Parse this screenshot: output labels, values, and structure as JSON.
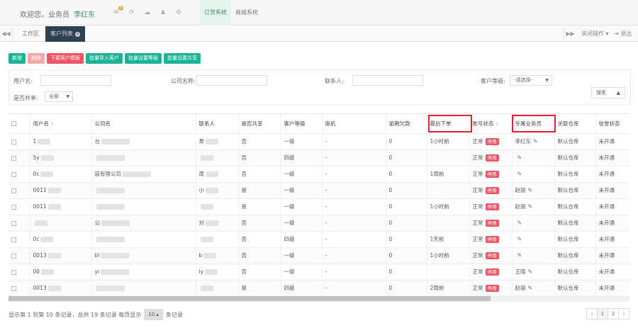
{
  "header": {
    "welcome": "欢迎您，业务员",
    "username": "李红东",
    "icons": [
      "envelope-icon",
      "refresh-icon",
      "cloud-icon",
      "user-icon",
      "gear-icon"
    ],
    "mail_badge": "1",
    "nav": [
      "订货系统",
      "商城系统"
    ]
  },
  "tabs": {
    "left_arrow": "◀◀",
    "items": [
      "工作区",
      "客户列表"
    ],
    "right_arrow": "▶▶",
    "close_ops": "关闭操作",
    "exit": "退出"
  },
  "toolbar": {
    "buttons": [
      "新增",
      "删除",
      "下载客户模板",
      "批量导入客户",
      "批量设置等级",
      "批量设置共享"
    ]
  },
  "search": {
    "username_label": "用户名:",
    "company_label": "公司名称:",
    "contact_label": "联系人:",
    "level_label": "客户等级:",
    "level_value": "-请选择-",
    "shared_label": "是否共享:",
    "shared_value": "全部",
    "collapse_label": "搜索"
  },
  "table": {
    "headers": [
      "用户名",
      "公司名",
      "联系人",
      "是否共享",
      "客户等级",
      "座机",
      "逾期欠款",
      "最后下单",
      "账号状态",
      "专属业务员",
      "关联仓库",
      "信誉状态"
    ],
    "rows": [
      {
        "user": "1",
        "company": "台",
        "contact": "寿",
        "shared": "否",
        "level": "一级",
        "phone": "-",
        "debt": "0",
        "last_order": "1小时前",
        "status": "正常",
        "badge": "停用",
        "salesman": "李红东",
        "warehouse": "默认仓库",
        "credit": "未开通"
      },
      {
        "user": "5y",
        "company": "",
        "contact": "",
        "shared": "否",
        "level": "四级",
        "phone": "-",
        "debt": "0",
        "last_order": "",
        "status": "正常",
        "badge": "停用",
        "salesman": "",
        "warehouse": "默认仓库",
        "credit": "未开通"
      },
      {
        "user": "0c",
        "company": "装有限公司",
        "contact": "周",
        "shared": "否",
        "level": "一级",
        "phone": "-",
        "debt": "0",
        "last_order": "1周前",
        "status": "正常",
        "badge": "停用",
        "salesman": "",
        "warehouse": "默认仓库",
        "credit": "未开通"
      },
      {
        "user": "0011",
        "company": "",
        "contact": "小",
        "shared": "是",
        "level": "一级",
        "phone": "-",
        "debt": "0",
        "last_order": "",
        "status": "正常",
        "badge": "停用",
        "salesman": "赵丽",
        "warehouse": "默认仓库",
        "credit": "未开通"
      },
      {
        "user": "0011",
        "company": "",
        "contact": "",
        "shared": "是",
        "level": "一级",
        "phone": "-",
        "debt": "0",
        "last_order": "1小时前",
        "status": "正常",
        "badge": "停用",
        "salesman": "赵丽",
        "warehouse": "默认仓库",
        "credit": "未开通"
      },
      {
        "user": "",
        "company": "公",
        "contact": "刘",
        "shared": "否",
        "level": "一级",
        "phone": "-",
        "debt": "0",
        "last_order": "",
        "status": "正常",
        "badge": "停用",
        "salesman": "",
        "warehouse": "默认仓库",
        "credit": "未开通"
      },
      {
        "user": "0c",
        "company": "",
        "contact": "",
        "shared": "否",
        "level": "四级",
        "phone": "-",
        "debt": "0",
        "last_order": "1天前",
        "status": "正常",
        "badge": "停用",
        "salesman": "",
        "warehouse": "默认仓库",
        "credit": "未开通"
      },
      {
        "user": "0013",
        "company": "bi",
        "contact": "b",
        "shared": "否",
        "level": "一级",
        "phone": "-",
        "debt": "0",
        "last_order": "1小时前",
        "status": "正常",
        "badge": "停用",
        "salesman": "",
        "warehouse": "默认仓库",
        "credit": "未开通"
      },
      {
        "user": "00",
        "company": "yi",
        "contact": "ly",
        "shared": "否",
        "level": "一级",
        "phone": "-",
        "debt": "0",
        "last_order": "",
        "status": "正常",
        "badge": "停用",
        "salesman": "王晓",
        "warehouse": "默认仓库",
        "credit": "未开通"
      },
      {
        "user": "0013",
        "company": "",
        "contact": "",
        "shared": "是",
        "level": "四级",
        "phone": "-",
        "debt": "0",
        "last_order": "2周前",
        "status": "正常",
        "badge": "停用",
        "salesman": "赵丽",
        "warehouse": "默认仓库",
        "credit": "未开通"
      }
    ]
  },
  "footer": {
    "summary": "显示第 1 到第 10 条记录，总共 19 条记录 每页显示",
    "page_size": "10",
    "suffix": "条记录",
    "pages": [
      "‹",
      "1",
      "2",
      "›"
    ]
  }
}
